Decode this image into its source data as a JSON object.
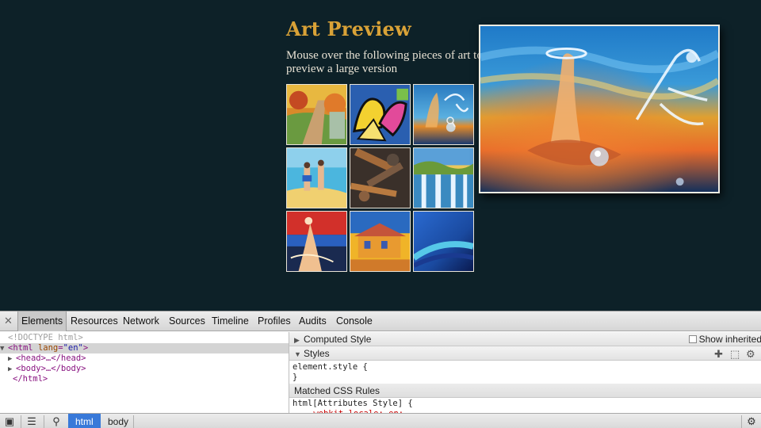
{
  "page": {
    "title": "Art Preview",
    "subtitle": "Mouse over the following pieces of art to preview a large version"
  },
  "thumbnails": [
    {
      "name": "thumb-autumn-path",
      "colors": [
        "#e39a2c",
        "#5a8a3a",
        "#c4542a"
      ]
    },
    {
      "name": "thumb-graffiti",
      "colors": [
        "#f3d130",
        "#2a5fb0",
        "#d43b8a"
      ]
    },
    {
      "name": "thumb-water-splash",
      "colors": [
        "#1f6fb3",
        "#e3862a",
        "#9fd6f0"
      ]
    },
    {
      "name": "thumb-beach-painting",
      "colors": [
        "#49b6de",
        "#f0d070",
        "#e88a3a"
      ]
    },
    {
      "name": "thumb-rusty-tools",
      "colors": [
        "#5a4a3e",
        "#a36a3a",
        "#2a2622"
      ]
    },
    {
      "name": "thumb-waterfall",
      "colors": [
        "#3a9bd0",
        "#e9c85c",
        "#6a8a3a"
      ]
    },
    {
      "name": "thumb-red-splash",
      "colors": [
        "#d2302a",
        "#1a4fa0",
        "#f0c090"
      ]
    },
    {
      "name": "thumb-yellow-house",
      "colors": [
        "#f0b428",
        "#2a6ac0",
        "#c4543a"
      ]
    },
    {
      "name": "thumb-blue-abstract",
      "colors": [
        "#1a4aa0",
        "#56c8e8",
        "#0a1a50"
      ]
    }
  ],
  "devtools": {
    "tabs": [
      "Elements",
      "Resources",
      "Network",
      "Sources",
      "Timeline",
      "Profiles",
      "Audits",
      "Console"
    ],
    "active_tab": "Elements",
    "dom": {
      "doctype": "<!DOCTYPE html>",
      "html_open_tag": "html",
      "html_attr_name": "lang",
      "html_attr_value": "\"en\"",
      "head": "<head>…</head>",
      "body": "<body>…</body>",
      "html_close": "</html>"
    },
    "computed_style": "Computed Style",
    "show_inherited": "Show inherited",
    "styles": "Styles",
    "element_style": "element.style {",
    "close_brace": "}",
    "matched_css_rules": "Matched CSS Rules",
    "rule_selector": "html[Attributes Style] {",
    "rule_property": "-webkit-locale: en;",
    "breadcrumbs": [
      "html",
      "body"
    ]
  }
}
